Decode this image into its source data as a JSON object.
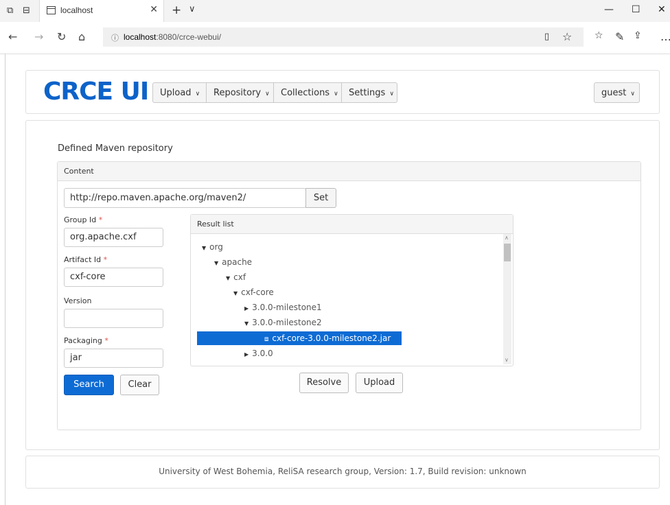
{
  "browser": {
    "tab_title": "localhost",
    "url_host": "localhost",
    "url_path": ":8080/crce-webui/"
  },
  "header": {
    "logo": "CRCE UI",
    "menus": [
      "Upload",
      "Repository",
      "Collections",
      "Settings"
    ],
    "user": "guest"
  },
  "main": {
    "title": "Defined Maven repository",
    "panel_title": "Content",
    "repo_url": "http://repo.maven.apache.org/maven2/",
    "set_label": "Set",
    "group_id_label": "Group Id",
    "group_id_value": "org.apache.cxf",
    "artifact_id_label": "Artifact Id",
    "artifact_id_value": "cxf-core",
    "version_label": "Version",
    "version_value": "",
    "packaging_label": "Packaging",
    "packaging_value": "jar",
    "required_mark": "*",
    "search_label": "Search",
    "clear_label": "Clear",
    "result_title": "Result list",
    "tree": [
      {
        "label": "org",
        "state": "expanded"
      },
      {
        "label": "apache",
        "state": "expanded"
      },
      {
        "label": "cxf",
        "state": "expanded"
      },
      {
        "label": "cxf-core",
        "state": "expanded"
      },
      {
        "label": "3.0.0-milestone1",
        "state": "collapsed"
      },
      {
        "label": "3.0.0-milestone2",
        "state": "expanded"
      },
      {
        "label": "cxf-core-3.0.0-milestone2.jar",
        "state": "file",
        "selected": true
      },
      {
        "label": "3.0.0",
        "state": "collapsed"
      }
    ],
    "resolve_label": "Resolve",
    "upload_label": "Upload"
  },
  "footer": {
    "text": "University of West Bohemia, ReliSA research group, Version: 1.7, Build revision: unknown"
  },
  "colors": {
    "brand": "#0d63c9",
    "primary_button": "#0e6bd4",
    "required": "#d9534f"
  }
}
